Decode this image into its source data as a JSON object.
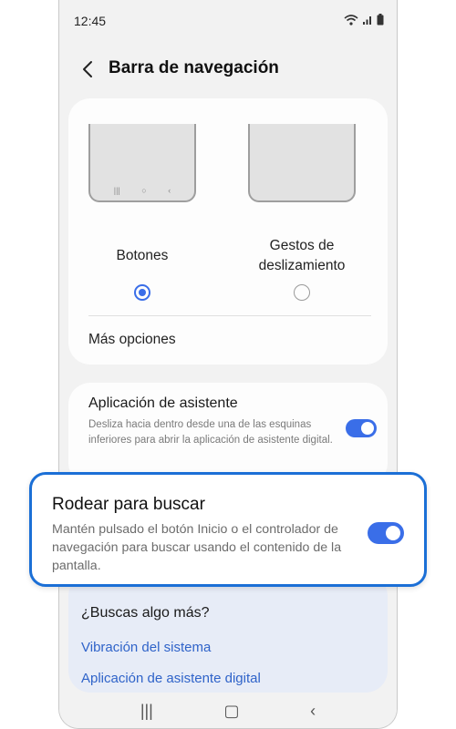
{
  "status_bar": {
    "time": "12:45"
  },
  "header": {
    "title": "Barra de navegación"
  },
  "nav_type": {
    "option_buttons": "Botones",
    "option_gestures_line1": "Gestos de",
    "option_gestures_line2": "deslizamiento",
    "selected": "Botones",
    "more_options": "Más opciones"
  },
  "assistant": {
    "title": "Aplicación de asistente",
    "description": "Desliza hacia dentro desde una de las esquinas inferiores para abrir la aplicación de asistente digital.",
    "enabled": true
  },
  "circle_to_search": {
    "title": "Rodear para buscar",
    "description": "Mantén pulsado el botón Inicio o el controlador de navegación para buscar usando el contenido de la pantalla.",
    "enabled": true
  },
  "suggestions": {
    "title": "¿Buscas algo más?",
    "links": [
      "Vibración del sistema",
      "Aplicación de asistente digital"
    ]
  },
  "colors": {
    "accent": "#3a6ee8",
    "highlight_border": "#1b6fd6",
    "link": "#2f63c9"
  }
}
